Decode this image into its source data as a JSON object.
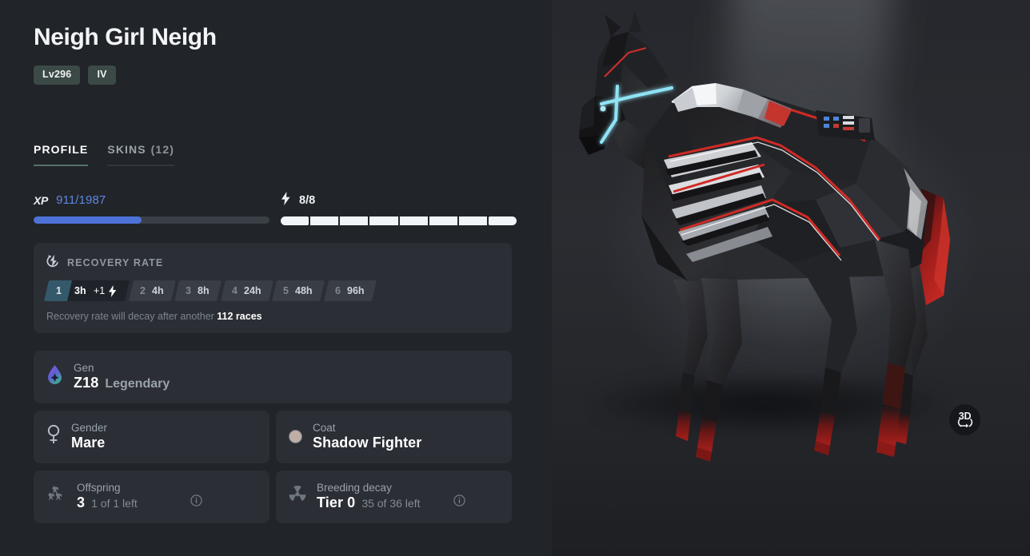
{
  "header": {
    "title": "Neigh Girl Neigh",
    "badges": [
      {
        "name": "level-badge",
        "label": "Lv296"
      },
      {
        "name": "generation-badge",
        "label": "IV"
      }
    ]
  },
  "tabs": [
    {
      "label": "PROFILE",
      "count": "",
      "active": true
    },
    {
      "label": "SKINS",
      "count": "(12)",
      "active": false
    }
  ],
  "stats": {
    "xp": {
      "tag": "XP",
      "value": "911/1987",
      "current": 911,
      "max": 1987,
      "percent": 45.8,
      "bar_color": "#4d73d8"
    },
    "energy": {
      "icon": "lightning-bolt-icon",
      "value": "8/8",
      "current": 8,
      "max": 8,
      "segment_color": "#f1f5fa"
    }
  },
  "recovery": {
    "icon": "recovery-rate-icon",
    "title": "RECOVERY RATE",
    "steps": [
      {
        "index": "1",
        "time": "3h",
        "bonus": "+1",
        "bolt": true,
        "active": true
      },
      {
        "index": "2",
        "time": "4h",
        "bonus": "",
        "bolt": false,
        "active": false
      },
      {
        "index": "3",
        "time": "8h",
        "bonus": "",
        "bolt": false,
        "active": false
      },
      {
        "index": "4",
        "time": "24h",
        "bonus": "",
        "bolt": false,
        "active": false
      },
      {
        "index": "5",
        "time": "48h",
        "bonus": "",
        "bolt": false,
        "active": false
      },
      {
        "index": "6",
        "time": "96h",
        "bonus": "",
        "bolt": false,
        "active": false
      }
    ],
    "note_prefix": "Recovery rate will decay after another ",
    "note_highlight": "112 races"
  },
  "cards": {
    "gen": {
      "icon": "gen-droplet-icon",
      "label": "Gen",
      "value": "Z18",
      "sub": "Legendary"
    },
    "gender": {
      "icon": "female-symbol-icon",
      "label": "Gender",
      "value": "Mare"
    },
    "coat": {
      "icon": "coat-swatch-icon",
      "label": "Coat",
      "value": "Shadow Fighter",
      "swatch_color": "#bfada6"
    },
    "offspring": {
      "icon": "horses-icon",
      "label": "Offspring",
      "value": "3",
      "sub": "1 of 1 left",
      "info_icon": "info-icon"
    },
    "breeding_decay": {
      "icon": "radiation-icon",
      "label": "Breeding decay",
      "value": "Tier 0",
      "sub": "35 of 36 left",
      "info_icon": "info-icon"
    }
  },
  "viewer": {
    "subject": "low-poly-horse-render",
    "button_3d": {
      "icon": "rotate-3d-icon",
      "label": "3D"
    }
  }
}
